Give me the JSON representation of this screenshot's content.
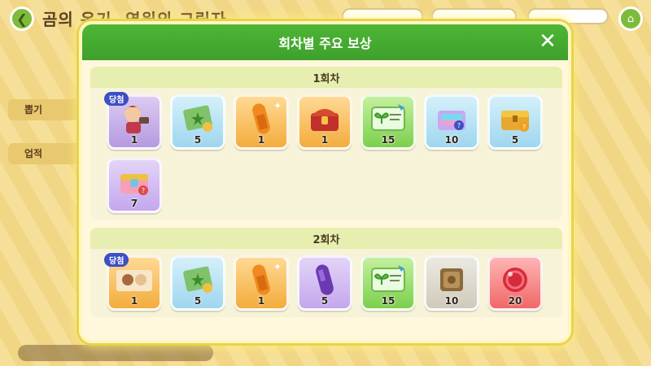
{
  "background": {
    "title": "곰의 온기, 염원의 그림자",
    "tabs": [
      "뽑기",
      "업적"
    ]
  },
  "modal": {
    "title": "회차별 주요 보상",
    "rounds": [
      {
        "label": "1회차",
        "items": [
          {
            "icon": "cookie-character-icon",
            "count": "1",
            "badge": "당첨",
            "color": "purple"
          },
          {
            "icon": "green-ticket-icon",
            "count": "5",
            "color": "blue"
          },
          {
            "icon": "orange-crystal-icon",
            "count": "1",
            "color": "orange"
          },
          {
            "icon": "treasure-chest-icon",
            "count": "1",
            "color": "orange"
          },
          {
            "icon": "sprout-card-icon",
            "count": "15",
            "color": "green"
          },
          {
            "icon": "rainbow-box-icon",
            "count": "10",
            "color": "blue"
          },
          {
            "icon": "gold-box-icon",
            "count": "5",
            "color": "blue"
          },
          {
            "icon": "pink-box-icon",
            "count": "7",
            "color": "lpurple"
          }
        ]
      },
      {
        "label": "2회차",
        "items": [
          {
            "icon": "costume-scene-icon",
            "count": "1",
            "badge": "당첨",
            "color": "orange"
          },
          {
            "icon": "green-ticket-icon",
            "count": "5",
            "color": "blue"
          },
          {
            "icon": "orange-crystal-icon",
            "count": "1",
            "color": "orange"
          },
          {
            "icon": "purple-crystal-icon",
            "count": "5",
            "color": "lpurple"
          },
          {
            "icon": "sprout-card-icon",
            "count": "15",
            "color": "green"
          },
          {
            "icon": "stone-tablet-icon",
            "count": "10",
            "color": "gray"
          },
          {
            "icon": "red-candy-icon",
            "count": "20",
            "color": "red"
          }
        ]
      }
    ]
  }
}
